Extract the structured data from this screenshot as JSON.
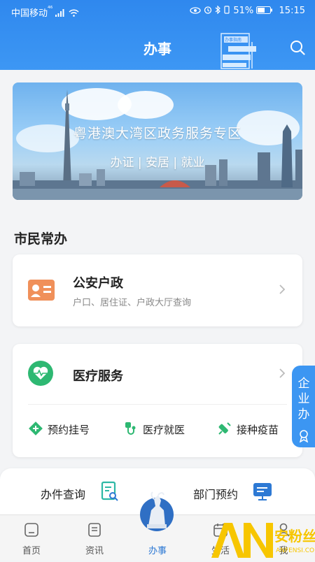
{
  "status_bar": {
    "carrier": "中国移动",
    "network": "⁴⁶",
    "battery": "51%",
    "time": "15:15"
  },
  "header": {
    "title": "办事",
    "guide_label": "办事指南"
  },
  "banner": {
    "title": "粤港澳大湾区政务服务专区",
    "subtitle": "办证 | 安居 | 就业"
  },
  "section": {
    "title": "市民常办"
  },
  "cards": [
    {
      "title": "公安户政",
      "subtitle": "户口、居住证、户政大厅查询"
    },
    {
      "title": "医疗服务",
      "services": [
        "预约挂号",
        "医疗就医",
        "接种疫苗"
      ]
    }
  ],
  "side_tab": {
    "label": "企业办"
  },
  "quick": {
    "query_label": "办件查询",
    "appoint_label": "部门预约"
  },
  "tabbar": {
    "items": [
      "首页",
      "资讯",
      "办事",
      "生活",
      "我"
    ]
  },
  "watermark": {
    "brand": "安粉丝",
    "url": "ANFENSI.COM"
  },
  "colors": {
    "header_blue": "#2f88ee",
    "accent_green": "#2eb872",
    "accent_orange": "#f0905a",
    "tab_active": "#2d79d4"
  }
}
